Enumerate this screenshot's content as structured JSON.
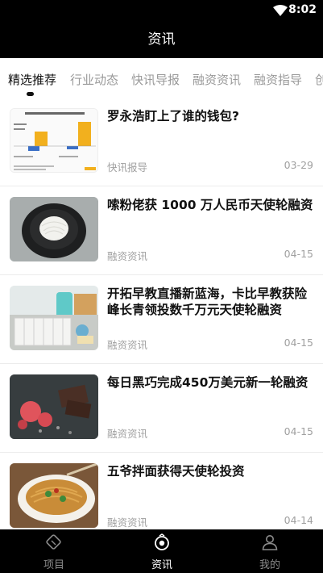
{
  "status": {
    "time": "8:02"
  },
  "header": {
    "title": "资讯"
  },
  "tabs": [
    {
      "label": "精选推荐"
    },
    {
      "label": "行业动态"
    },
    {
      "label": "快讯导报"
    },
    {
      "label": "融资资讯"
    },
    {
      "label": "融资指导"
    },
    {
      "label": "创"
    }
  ],
  "articles": [
    {
      "title": "罗永浩盯上了谁的钱包?",
      "category": "快讯报导",
      "date": "03-29"
    },
    {
      "title": "嗦粉佬获 1000 万人民币天使轮融资",
      "category": "融资资讯",
      "date": "04-15"
    },
    {
      "title": "开拓早教直播新蓝海，卡比早教获险峰长青领投数千万元天使轮融资",
      "category": "融资资讯",
      "date": "04-15"
    },
    {
      "title": "每日黑巧完成450万美元新一轮融资",
      "category": "融资资讯",
      "date": "04-15"
    },
    {
      "title": "五爷拌面获得天使轮投资",
      "category": "融资资讯",
      "date": "04-14"
    }
  ],
  "nav": [
    {
      "label": "项目",
      "icon": "project-icon"
    },
    {
      "label": "资讯",
      "icon": "news-icon"
    },
    {
      "label": "我的",
      "icon": "profile-icon"
    }
  ]
}
